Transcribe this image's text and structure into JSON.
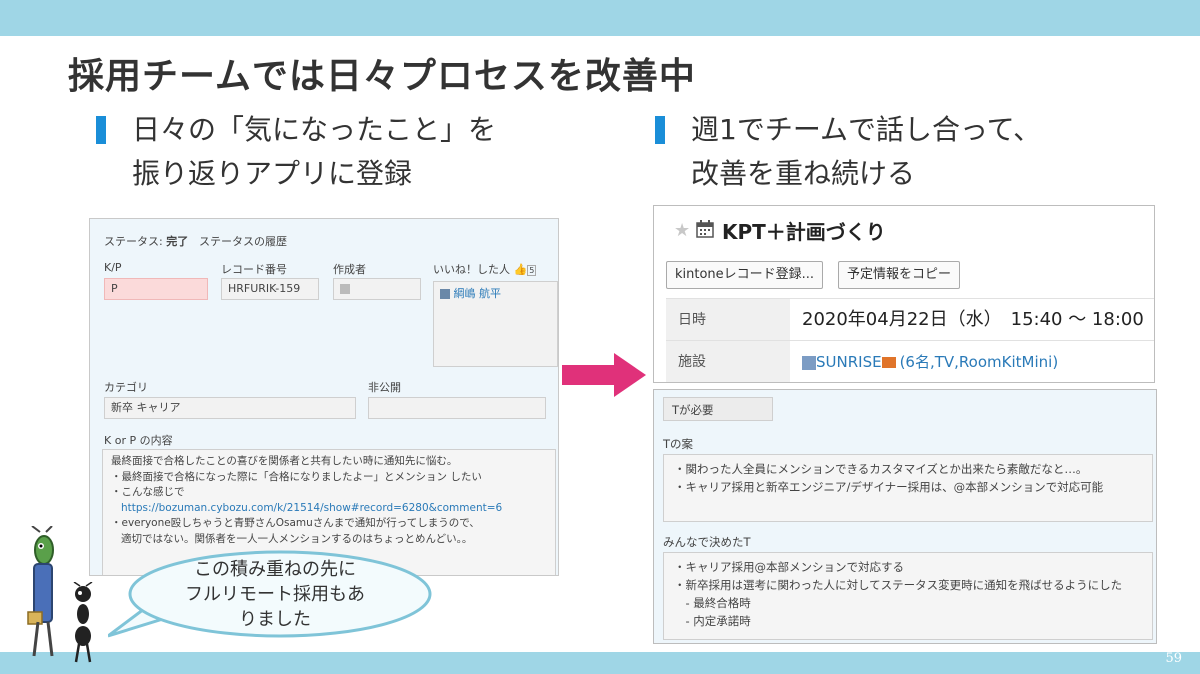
{
  "slide": {
    "title": "採用チームでは日々プロセスを改善中",
    "page_number": "59",
    "left_bullet": [
      "日々の「気になったこと」を",
      "振り返りアプリに登録"
    ],
    "right_bullet": [
      "週1でチームで話し合って、",
      "改善を重ね続ける"
    ],
    "bubble": [
      "この積み重ねの先に",
      "フルリモート採用もあ",
      "りました"
    ]
  },
  "record": {
    "status_label": "ステータス:",
    "status_value": "完了",
    "status_history_link": "ステータスの履歴",
    "kp_label": "K/P",
    "kp_value": "P",
    "record_no_label": "レコード番号",
    "record_no_value": "HRFURIK-159",
    "author_label": "作成者",
    "like_label": "いいね！した人",
    "like_count": "5",
    "liker_name": "綱嶋 航平",
    "category_label": "カテゴリ",
    "category_value": "新卒 キャリア",
    "private_label": "非公開",
    "content_label": "K or P の内容",
    "content_lines": [
      "最終面接で合格したことの喜びを関係者と共有したい時に通知先に悩む。",
      "",
      "・最終面接で合格になった際に「合格になりましたよー」とメンション したい",
      "・こんな感じで",
      "https://bozuman.cybozu.com/k/21514/show#record=6280&comment=6",
      "・everyone殴しちゃうと青野さんOsamuさんまで通知が行ってしまうので、",
      "適切ではない。関係者を一人一人メンションするのはちょっとめんどい。。"
    ]
  },
  "schedule": {
    "title": "KPT＋計画づくり",
    "btn_record": "kintoneレコード登録...",
    "btn_copy": "予定情報をコピー",
    "date_label": "日時",
    "date_value": "2020年04月22日（水）　15:40 〜 18:00",
    "facility_label": "施設",
    "facility_name": "SUNRISE",
    "facility_detail": "(6名,TV,RoomKitMini)"
  },
  "kpt": {
    "tag": "Tが必要",
    "t_label": "Tの案",
    "t_lines": [
      "・関わった人全員にメンションできるカスタマイズとか出来たら素敵だなと…。",
      "・キャリア採用と新卒エンジニア/デザイナー採用は、@本部メンションで対応可能"
    ],
    "decided_label": "みんなで決めたT",
    "decided_lines": [
      "・キャリア採用@本部メンションで対応する",
      "・新卒採用は選考に関わった人に対してステータス変更時に通知を飛ばせるようにした",
      "　- 最終合格時",
      "　- 内定承諾時"
    ]
  },
  "colors": {
    "band": "#9fd6e6",
    "bullet_mark": "#1a8ed8",
    "arrow": "#e0317a",
    "link": "#2a7ab8"
  }
}
